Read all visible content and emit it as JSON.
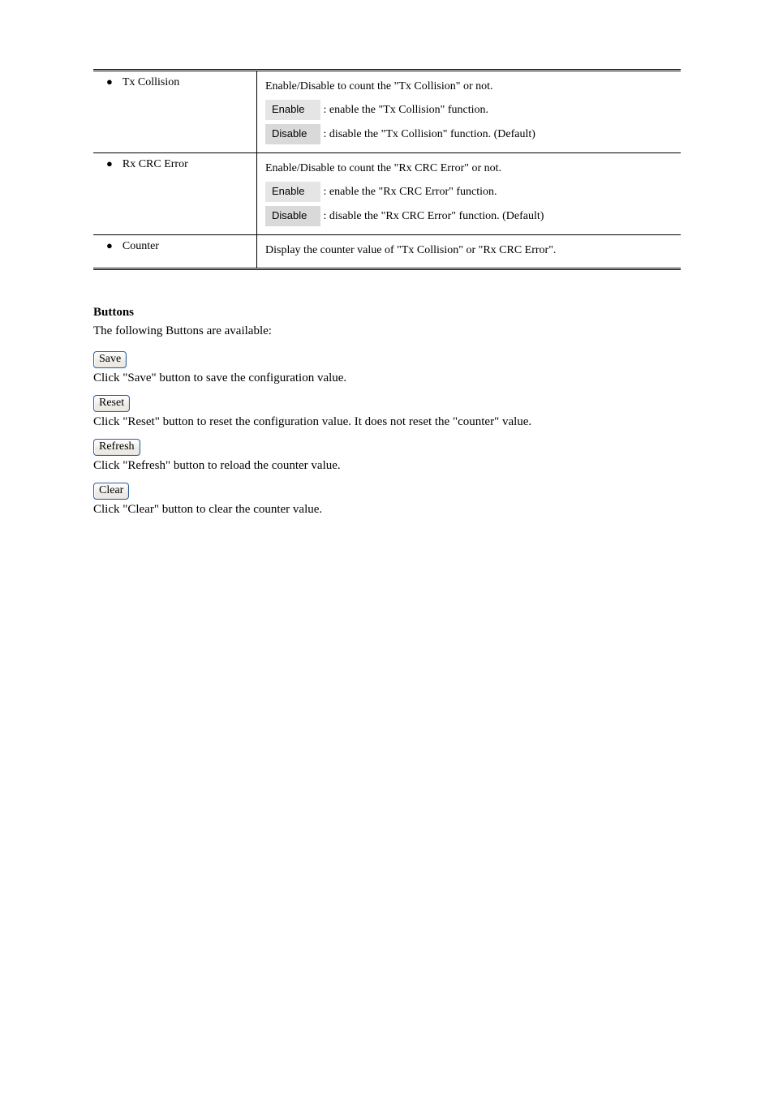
{
  "table": {
    "rows": [
      {
        "label": "Tx Collision",
        "desc_line": "Enable/Disable to count the \"Tx Collision\" or not.",
        "opt_enable": "Enable",
        "opt_disable": "Disable",
        "desc_enable": ": enable the \"Tx Collision\" function.",
        "desc_disable": ": disable the \"Tx Collision\" function. (Default)"
      },
      {
        "label": "Rx CRC Error",
        "desc_line": "Enable/Disable to count the \"Rx CRC Error\" or not.",
        "opt_enable": "Enable",
        "opt_disable": "Disable",
        "desc_enable": ": enable the \"Rx CRC Error\" function.",
        "desc_disable": ": disable the \"Rx CRC Error\" function. (Default)"
      },
      {
        "label": "Counter",
        "desc": "Display the counter value of \"Tx Collision\" or \"Rx CRC Error\"."
      }
    ]
  },
  "buttons_heading": "Buttons",
  "buttons_desc": "The following Buttons are available:",
  "buttons": [
    {
      "label": "Save",
      "desc": "Click \"Save\" button to save the configuration value."
    },
    {
      "label": "Reset",
      "desc": "Click \"Reset\" button to reset the configuration value. It does not reset the \"counter\" value."
    },
    {
      "label": "Refresh",
      "desc": "Click \"Refresh\" button to reload the counter value."
    },
    {
      "label": "Clear",
      "desc": "Click \"Clear\" button to clear the counter value."
    }
  ]
}
